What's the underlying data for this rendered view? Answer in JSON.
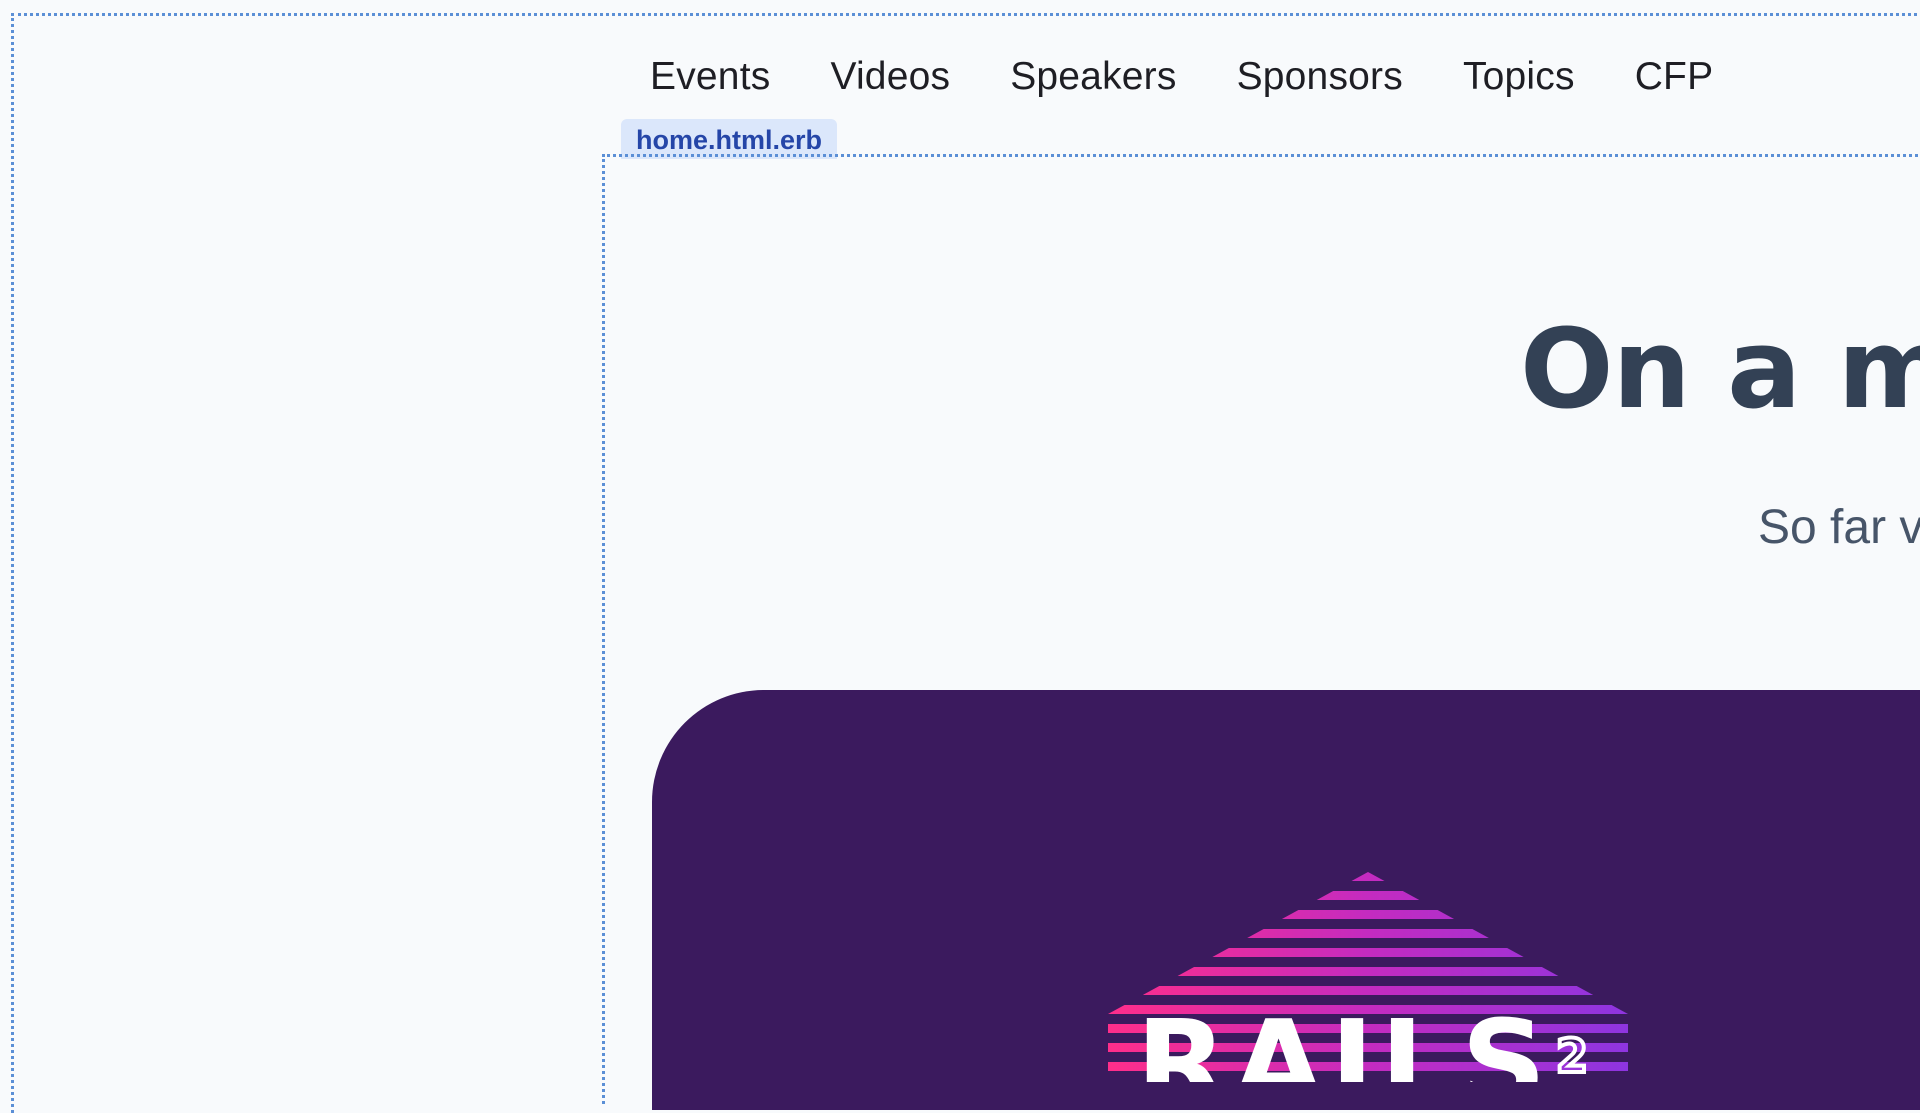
{
  "nav": {
    "items": [
      {
        "label": "Events"
      },
      {
        "label": "Videos"
      },
      {
        "label": "Speakers"
      },
      {
        "label": "Sponsors"
      },
      {
        "label": "Topics"
      },
      {
        "label": "CFP"
      }
    ]
  },
  "file_tag": "home.html.erb",
  "hero": {
    "title": "On a mi",
    "subtitle": "So far v"
  },
  "banner": {
    "background_color": "#3b1a5e",
    "logo_text": "RAILS",
    "logo_icon": "house-stripes-logo"
  },
  "colors": {
    "debug_outline": "#5b8fd6",
    "tag_background": "#dbe7fb",
    "tag_text": "#2546a8",
    "title_text": "#334155"
  }
}
